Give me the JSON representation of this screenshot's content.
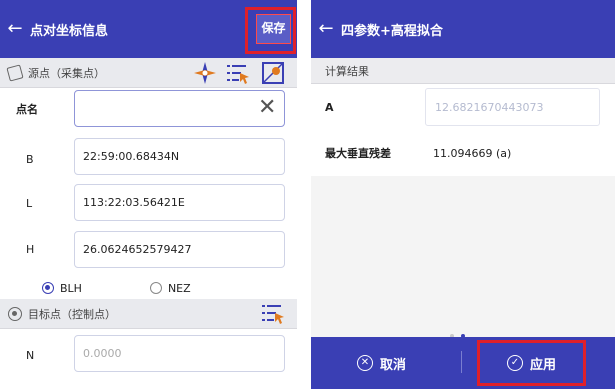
{
  "left": {
    "header": {
      "back_icon": "arrow-left-icon",
      "title": "点对坐标信息",
      "save_label": "保存"
    },
    "source_section": {
      "title": "源点（采集点）",
      "icons": [
        "compass-icon",
        "list-select-icon",
        "map-point-icon"
      ]
    },
    "fields": {
      "point_name": {
        "label": "点名",
        "value": ""
      },
      "B": {
        "label": "B",
        "value": "22:59:00.68434N"
      },
      "L": {
        "label": "L",
        "value": "113:22:03.56421E"
      },
      "H": {
        "label": "H",
        "value": "26.0624652579427"
      }
    },
    "coord_mode": {
      "options": [
        "BLH",
        "NEZ"
      ],
      "selected": "BLH"
    },
    "target_section": {
      "title": "目标点（控制点）",
      "icons": [
        "list-select-icon"
      ]
    },
    "N": {
      "label": "N",
      "placeholder": "0.0000"
    },
    "colors": {
      "primary": "#3a3fb4",
      "highlight": "#e0202a"
    }
  },
  "right": {
    "header": {
      "back_icon": "arrow-left-icon",
      "title": "四参数+高程拟合"
    },
    "section_title": "计算结果",
    "rows": [
      {
        "label": "A",
        "value": "12.6821670443073"
      },
      {
        "label": "最大垂直残差",
        "value": "11.094669 (a)"
      }
    ],
    "pager": {
      "count": 2,
      "active": 2
    },
    "footer": {
      "cancel_label": "取消",
      "apply_label": "应用"
    }
  }
}
